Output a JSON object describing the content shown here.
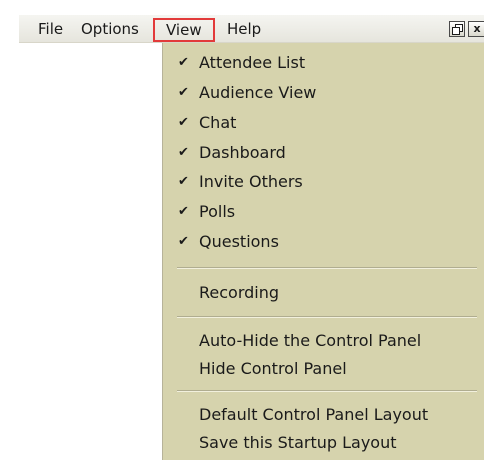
{
  "menubar": {
    "file": "File",
    "options": "Options",
    "view": "View",
    "help": "Help",
    "close": "x"
  },
  "view_menu": {
    "checked_items": [
      "Attendee List",
      "Audience View",
      "Chat",
      "Dashboard",
      "Invite Others",
      "Polls",
      "Questions"
    ],
    "checkmark": "✔",
    "recording": "Recording",
    "auto_hide": "Auto-Hide the Control Panel",
    "hide_control_panel": "Hide Control Panel",
    "default_layout": "Default Control Panel Layout",
    "save_startup_layout": "Save this Startup Layout"
  },
  "colors": {
    "menu_background": "#d6d3ad",
    "highlight_border": "#e23a3a"
  }
}
